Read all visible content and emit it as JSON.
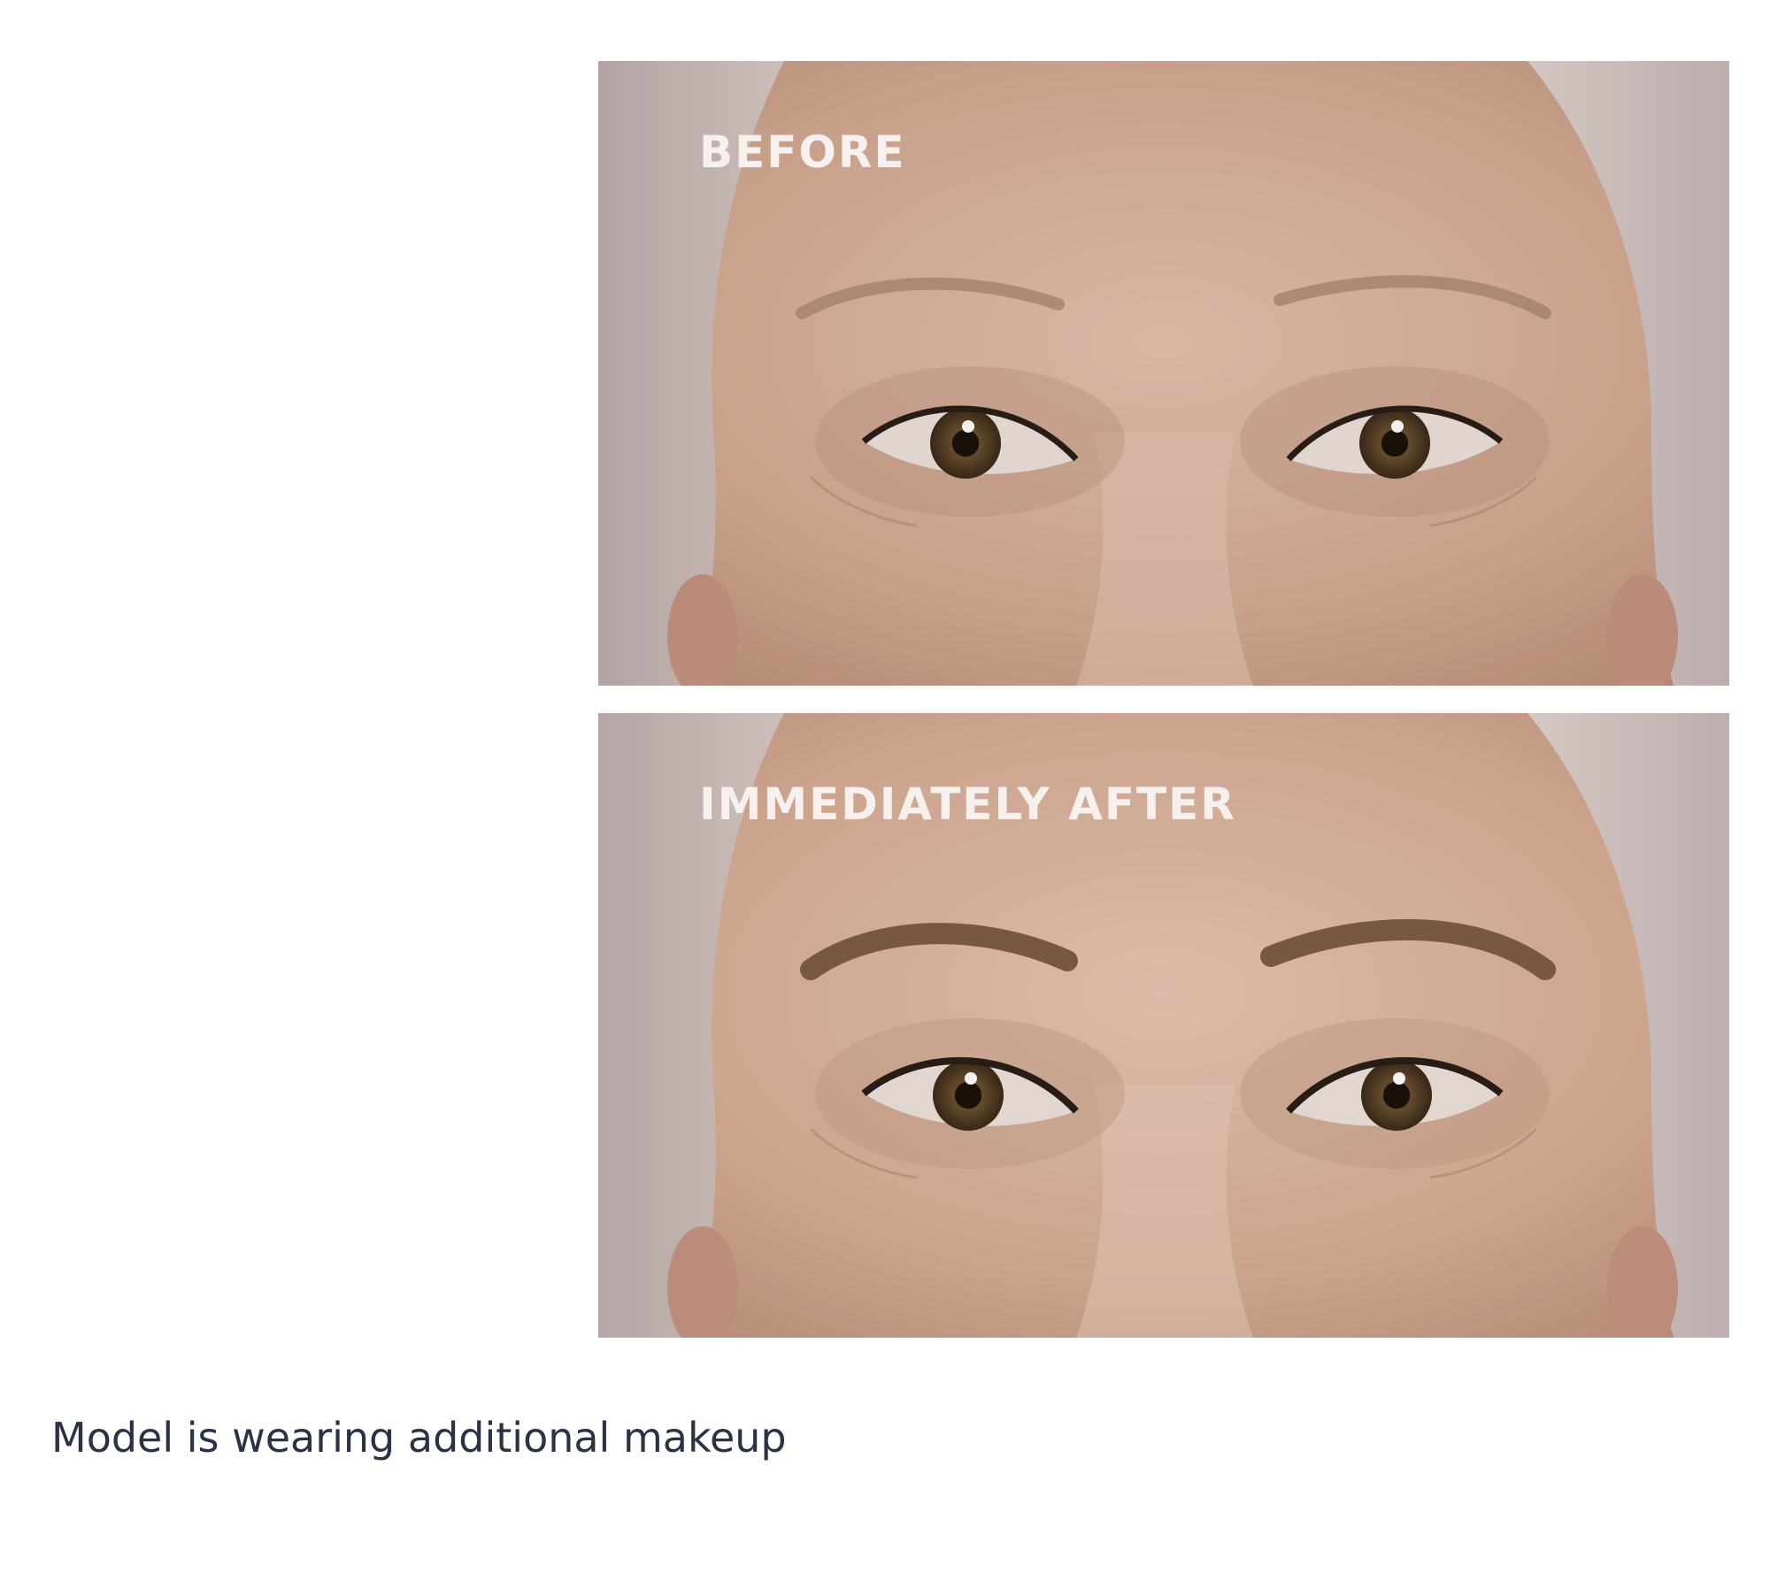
{
  "photos": [
    {
      "label": "BEFORE",
      "brows": "natural"
    },
    {
      "label": "IMMEDIATELY AFTER",
      "brows": "filled"
    }
  ],
  "caption": "Model is wearing additional makeup",
  "colors": {
    "background": "#ffffff",
    "caption_text": "#2a3245",
    "label_text": "#f6f1ee",
    "skin": "#d9b39c",
    "hair": "#cbbbb8",
    "iris": "#5a4528"
  }
}
